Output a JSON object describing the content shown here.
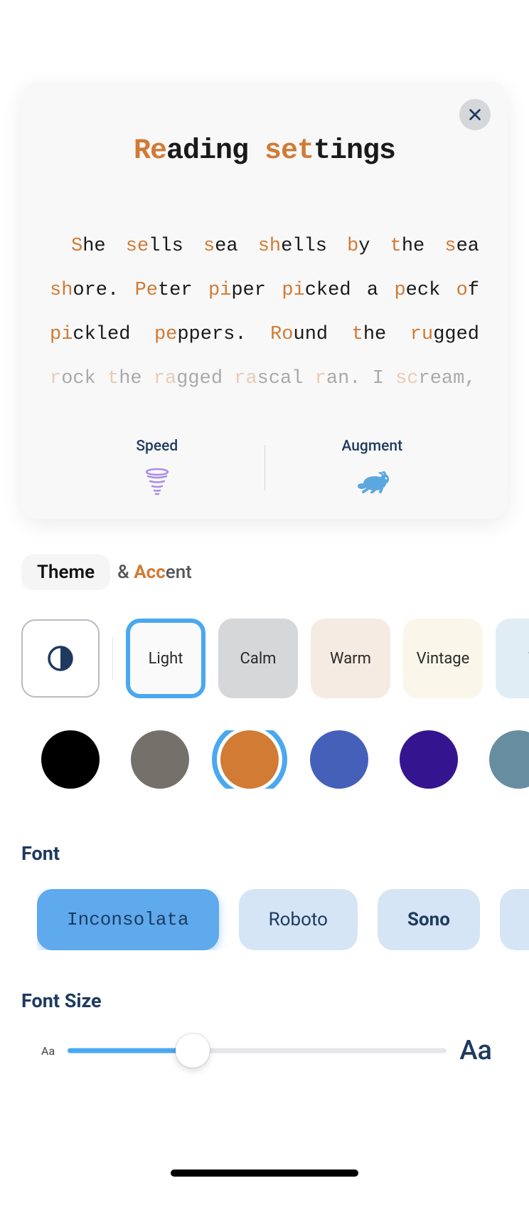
{
  "title": {
    "prefix1": "Re",
    "mid1": "ading ",
    "prefix2": "set",
    "mid2": "tings"
  },
  "sample_words": [
    {
      "hl": "S",
      "rest": "he"
    },
    {
      "hl": "se",
      "rest": "lls"
    },
    {
      "hl": "s",
      "rest": "ea"
    },
    {
      "hl": "sh",
      "rest": "ells"
    },
    {
      "hl": "b",
      "rest": "y"
    },
    {
      "hl": "t",
      "rest": "he"
    },
    {
      "hl": "s",
      "rest": "ea"
    },
    {
      "hl": "sh",
      "rest": "ore."
    },
    {
      "hl": "Pe",
      "rest": "ter"
    },
    {
      "hl": "pi",
      "rest": "per"
    },
    {
      "hl": "pi",
      "rest": "cked"
    },
    {
      "hl": "",
      "rest": "a"
    },
    {
      "hl": "p",
      "rest": "eck"
    },
    {
      "hl": "o",
      "rest": "f"
    },
    {
      "hl": "pi",
      "rest": "ckled"
    },
    {
      "hl": "pe",
      "rest": "ppers."
    },
    {
      "hl": "Ro",
      "rest": "und"
    },
    {
      "hl": "t",
      "rest": "he"
    },
    {
      "hl": "ru",
      "rest": "gged"
    },
    {
      "hl": "r",
      "rest": "ock",
      "fade": true
    },
    {
      "hl": "t",
      "rest": "he",
      "fade": true
    },
    {
      "hl": "ra",
      "rest": "gged",
      "fade": true
    },
    {
      "hl": "ra",
      "rest": "scal",
      "fade": true
    },
    {
      "hl": "r",
      "rest": "an.",
      "fade": true
    },
    {
      "hl": "",
      "rest": "I",
      "fade": true
    },
    {
      "hl": "sc",
      "rest": "ream,",
      "fade": true
    }
  ],
  "speed_label": "Speed",
  "augment_label": "Augment",
  "theme_heading": {
    "pill": "Theme",
    "amp": "& ",
    "acc_hl": "Acc",
    "acc_rest": "ent"
  },
  "themes": [
    {
      "label": "Light",
      "bg": "#fafafa",
      "selected": true
    },
    {
      "label": "Calm",
      "bg": "#d6d7d9",
      "selected": false
    },
    {
      "label": "Warm",
      "bg": "#f5ebe3",
      "selected": false
    },
    {
      "label": "Vintage",
      "bg": "#fbf6ea",
      "selected": false
    },
    {
      "label": "Tr",
      "bg": "#e0edf5",
      "selected": false
    }
  ],
  "accents": [
    {
      "color": "#000000",
      "selected": false
    },
    {
      "color": "#74706a",
      "selected": false
    },
    {
      "color": "#d17b34",
      "selected": true
    },
    {
      "color": "#4560b9",
      "selected": false
    },
    {
      "color": "#35148f",
      "selected": false
    },
    {
      "color": "#678da1",
      "selected": false
    }
  ],
  "font_heading": "Font",
  "fonts": [
    {
      "label": "Inconsolata",
      "selected": true,
      "mono": true,
      "weight": 500
    },
    {
      "label": "Roboto",
      "selected": false,
      "mono": false,
      "weight": 400
    },
    {
      "label": "Sono",
      "selected": false,
      "mono": false,
      "weight": 700
    }
  ],
  "font_size_heading": "Font Size",
  "slider": {
    "percent": 33
  },
  "aa_small": "Aa",
  "aa_big": "Aa",
  "colors": {
    "accent_orange": "#d17b34",
    "selection_blue": "#4aa8f0"
  }
}
